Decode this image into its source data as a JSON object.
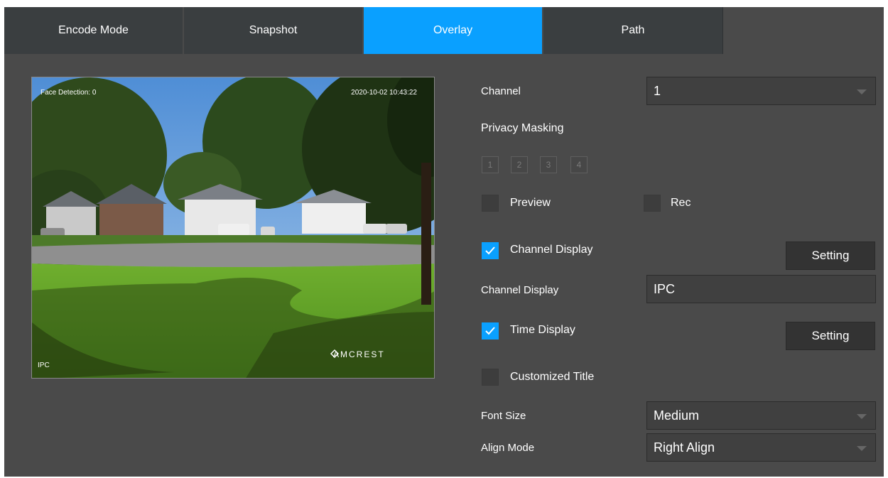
{
  "tabs": [
    {
      "label": "Encode Mode",
      "active": false
    },
    {
      "label": "Snapshot",
      "active": false
    },
    {
      "label": "Overlay",
      "active": true
    },
    {
      "label": "Path",
      "active": false
    }
  ],
  "preview": {
    "overlay_top_left": "Face Detection: 0",
    "overlay_top_right": "2020-10-02 10:43:22",
    "overlay_bottom_left": "IPC",
    "logo_text": "AMCREST"
  },
  "form": {
    "channel": {
      "label": "Channel",
      "value": "1"
    },
    "privacy_masking": {
      "label": "Privacy Masking",
      "regions": [
        "1",
        "2",
        "3",
        "4"
      ]
    },
    "preview": {
      "label": "Preview",
      "checked": false
    },
    "rec": {
      "label": "Rec",
      "checked": false
    },
    "channel_display_toggle": {
      "label": "Channel Display",
      "checked": true,
      "button": "Setting"
    },
    "channel_display_name": {
      "label": "Channel Display",
      "value": "IPC"
    },
    "time_display": {
      "label": "Time Display",
      "checked": true,
      "button": "Setting"
    },
    "customized_title": {
      "label": "Customized Title",
      "checked": false
    },
    "font_size": {
      "label": "Font Size",
      "value": "Medium"
    },
    "align_mode": {
      "label": "Align Mode",
      "value": "Right Align"
    }
  },
  "colors": {
    "accent": "#0aa0ff",
    "panel_bg": "#4a4a4a",
    "tab_bg": "#3a3e40",
    "input_bg": "#404040"
  },
  "icons": {
    "checkbox_checked": "check-icon",
    "dropdown": "chevron-down-icon",
    "logo": "amcrest-logo-icon"
  }
}
